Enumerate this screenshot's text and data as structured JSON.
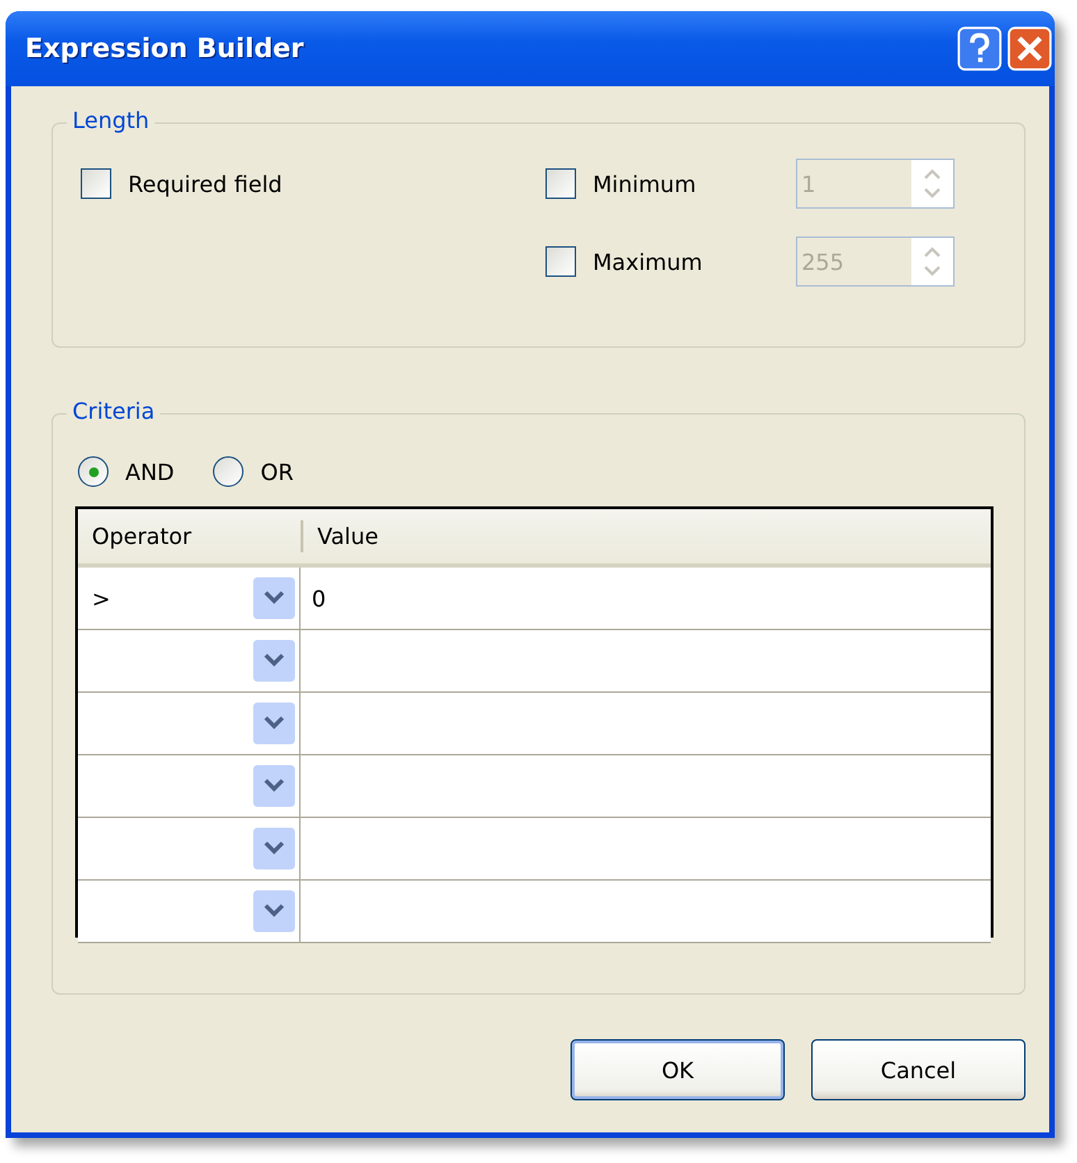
{
  "window": {
    "title": "Expression Builder"
  },
  "length": {
    "title": "Length",
    "required": {
      "label": "Required field",
      "checked": false
    },
    "limits": [
      {
        "label": "Minimum",
        "checked": false,
        "value": "1",
        "disabled": true
      },
      {
        "label": "Maximum",
        "checked": false,
        "value": "255",
        "disabled": true
      }
    ]
  },
  "criteria": {
    "title": "Criteria",
    "modes": [
      {
        "label": "AND",
        "selected": true
      },
      {
        "label": "OR",
        "selected": false
      }
    ],
    "table": {
      "columns": [
        "Operator",
        "Value"
      ],
      "rows": [
        {
          "operator": ">",
          "value": "0"
        },
        {},
        {},
        {},
        {},
        {}
      ]
    }
  },
  "buttons": [
    {
      "label": "OK",
      "default": true
    },
    {
      "label": "Cancel",
      "default": false
    }
  ]
}
